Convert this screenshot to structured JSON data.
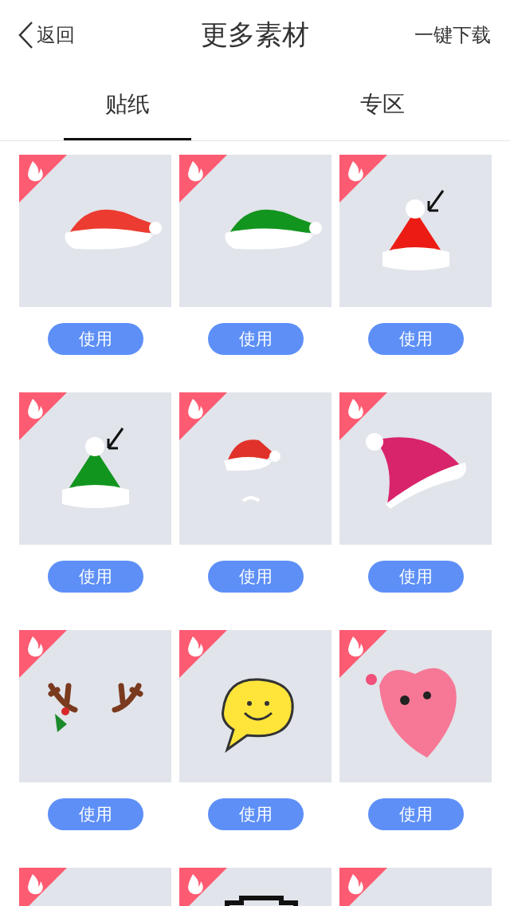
{
  "header": {
    "back": "返回",
    "title": "更多素材",
    "action": "一键下载"
  },
  "tabs": [
    {
      "label": "贴纸",
      "selected": true
    },
    {
      "label": "专区",
      "selected": false
    }
  ],
  "stickers": [
    {
      "kind": "hat",
      "color": "#ec3b30",
      "hot": true,
      "button": "使用"
    },
    {
      "kind": "hat",
      "color": "#12951e",
      "hot": true,
      "button": "使用"
    },
    {
      "kind": "gift-hat",
      "color": "#ec1c14",
      "hot": true,
      "button": "使用"
    },
    {
      "kind": "gift-hat",
      "color": "#12951e",
      "hot": true,
      "button": "使用"
    },
    {
      "kind": "small-hat",
      "color": "#e0322a",
      "hot": true,
      "button": "使用"
    },
    {
      "kind": "tilted-hat",
      "color": "#d8246a",
      "hot": true,
      "button": "使用"
    },
    {
      "kind": "antlers",
      "hot": true,
      "button": "使用"
    },
    {
      "kind": "smile",
      "hot": true,
      "button": "使用"
    },
    {
      "kind": "heart",
      "hot": true,
      "button": "使用"
    },
    {
      "kind": "blank",
      "hot": true
    },
    {
      "kind": "frame",
      "hot": true
    },
    {
      "kind": "blank",
      "hot": true
    }
  ]
}
